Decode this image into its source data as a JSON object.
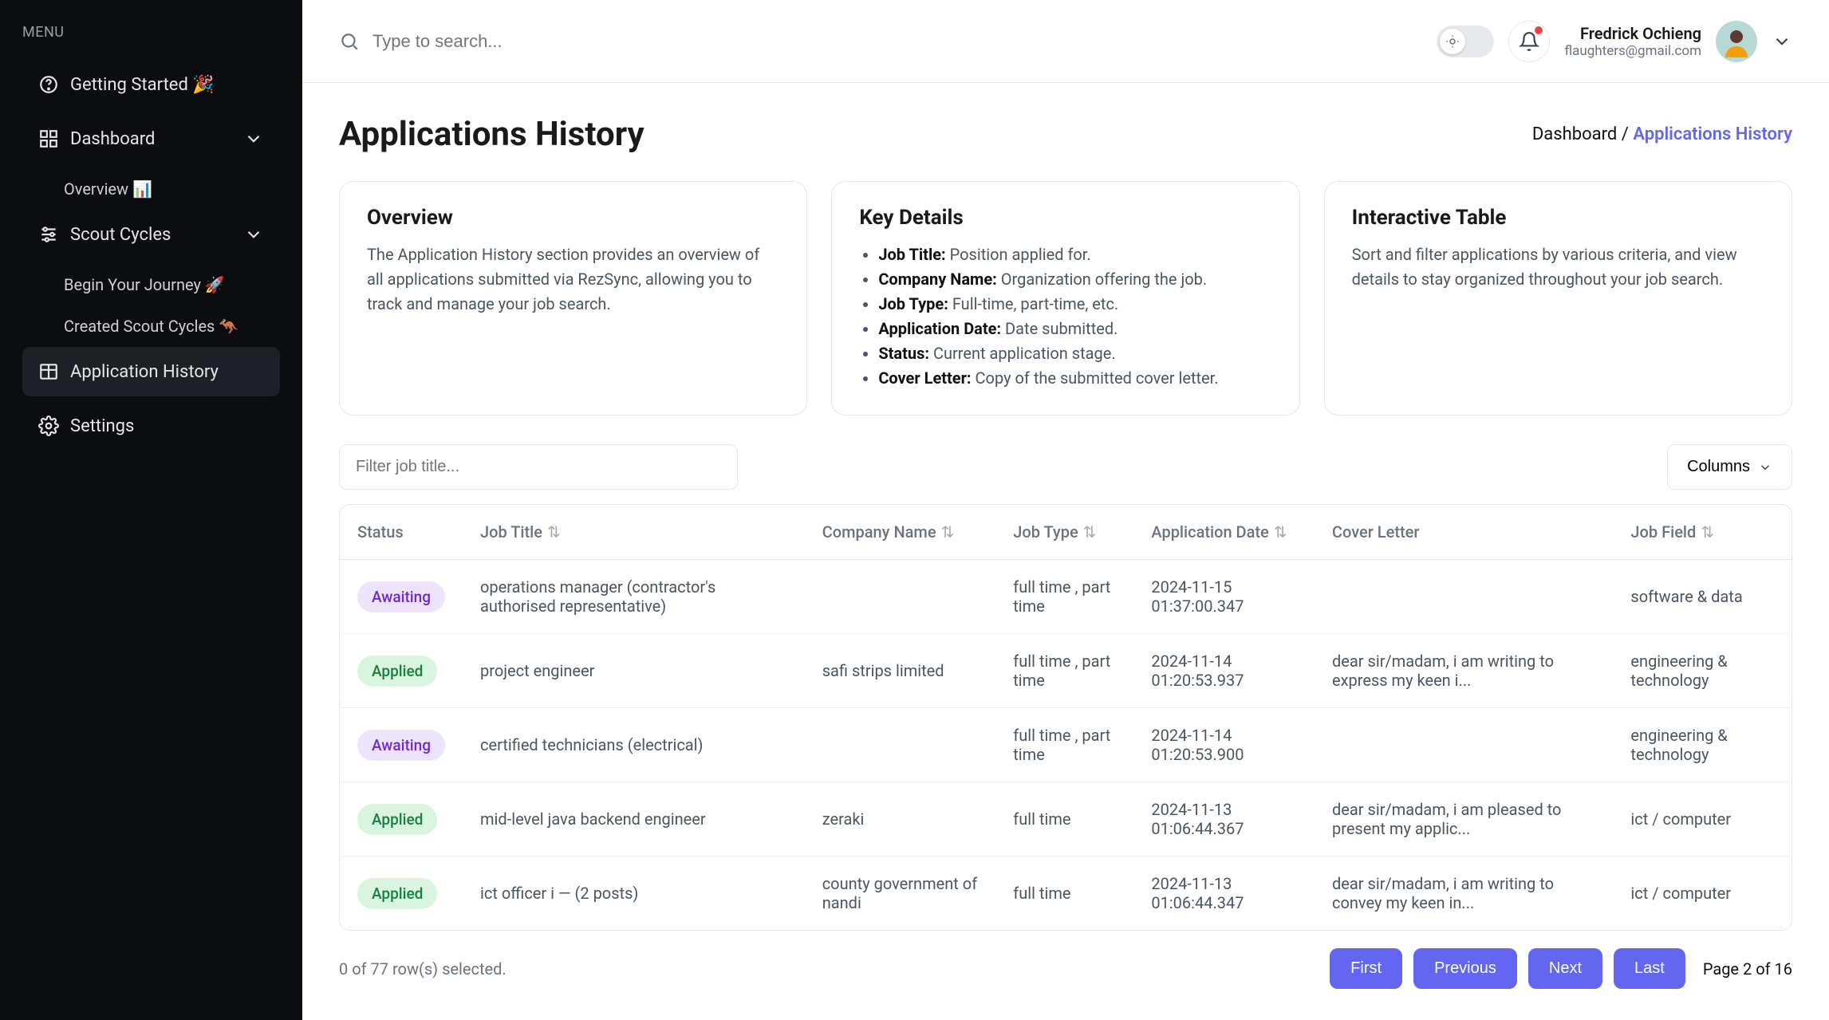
{
  "sidebar": {
    "menu_label": "MENU",
    "getting_started": "Getting Started 🎉",
    "dashboard": "Dashboard",
    "overview_sub": "Overview 📊",
    "scout_cycles": "Scout Cycles",
    "begin_journey": "Begin Your Journey 🚀",
    "created_cycles": "Created Scout Cycles 🦘",
    "application_history": "Application History",
    "settings": "Settings"
  },
  "topbar": {
    "search_placeholder": "Type to search...",
    "user_name": "Fredrick Ochieng",
    "user_email": "flaughters@gmail.com"
  },
  "page": {
    "title": "Applications History",
    "breadcrumb_root": "Dashboard",
    "breadcrumb_sep": "/",
    "breadcrumb_current": "Applications History"
  },
  "cards": {
    "overview": {
      "title": "Overview",
      "body": "The Application History section provides an overview of all applications submitted via RezSync, allowing you to track and manage your job search."
    },
    "key_details": {
      "title": "Key Details",
      "items": [
        {
          "k": "Job Title:",
          "v": "Position applied for."
        },
        {
          "k": "Company Name:",
          "v": "Organization offering the job."
        },
        {
          "k": "Job Type:",
          "v": "Full-time, part-time, etc."
        },
        {
          "k": "Application Date:",
          "v": "Date submitted."
        },
        {
          "k": "Status:",
          "v": "Current application stage."
        },
        {
          "k": "Cover Letter:",
          "v": "Copy of the submitted cover letter."
        }
      ]
    },
    "interactive": {
      "title": "Interactive Table",
      "body": "Sort and filter applications by various criteria, and view details to stay organized throughout your job search."
    }
  },
  "table": {
    "filter_placeholder": "Filter job title...",
    "columns_label": "Columns",
    "headers": {
      "status": "Status",
      "job_title": "Job Title",
      "company_name": "Company Name",
      "job_type": "Job Type",
      "application_date": "Application Date",
      "cover_letter": "Cover Letter",
      "job_field": "Job Field"
    },
    "rows": [
      {
        "status": "Awaiting",
        "status_kind": "awaiting",
        "job_title": "operations manager (contractor's authorised representative)",
        "company_name": "",
        "job_type": "full time , part time",
        "application_date": "2024-11-15 01:37:00.347",
        "cover_letter": "",
        "job_field": "software & data"
      },
      {
        "status": "Applied",
        "status_kind": "applied",
        "job_title": "project engineer",
        "company_name": "safi strips limited",
        "job_type": "full time , part time",
        "application_date": "2024-11-14 01:20:53.937",
        "cover_letter": "dear sir/madam, i am writing to express my keen i...",
        "job_field": "engineering & technology"
      },
      {
        "status": "Awaiting",
        "status_kind": "awaiting",
        "job_title": "certified technicians (electrical)",
        "company_name": "",
        "job_type": "full time , part time",
        "application_date": "2024-11-14 01:20:53.900",
        "cover_letter": "",
        "job_field": "engineering & technology"
      },
      {
        "status": "Applied",
        "status_kind": "applied",
        "job_title": "mid-level java backend engineer",
        "company_name": "zeraki",
        "job_type": "full time",
        "application_date": "2024-11-13 01:06:44.367",
        "cover_letter": "dear sir/madam, i am pleased to present my applic...",
        "job_field": "ict / computer"
      },
      {
        "status": "Applied",
        "status_kind": "applied",
        "job_title": "ict officer i — (2 posts)",
        "company_name": "county government of nandi",
        "job_type": "full time",
        "application_date": "2024-11-13 01:06:44.347",
        "cover_letter": "dear sir/madam, i am writing to convey my keen in...",
        "job_field": "ict / computer"
      }
    ],
    "footer": {
      "selection": "0 of 77 row(s) selected.",
      "first": "First",
      "previous": "Previous",
      "next": "Next",
      "last": "Last",
      "page_info": "Page 2 of 16"
    }
  }
}
